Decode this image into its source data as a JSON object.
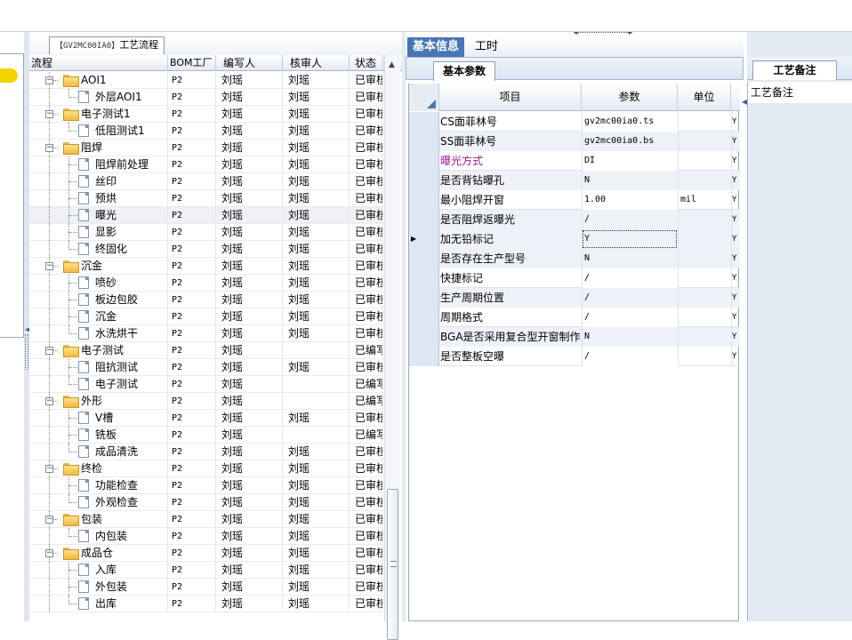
{
  "flow_panel": {
    "tab_title_code": "【GV2MC00IA0】",
    "tab_title_text": "工艺流程",
    "columns": [
      "流程",
      "BOM工厂",
      "编写人",
      "核审人",
      "状态"
    ],
    "rows": [
      {
        "name": "AOI1",
        "level": 0,
        "type": "folder",
        "bom": "P2",
        "writer": "刘瑶",
        "reviewer": "刘瑶",
        "status": "已审核"
      },
      {
        "name": "外层AOI1",
        "level": 1,
        "type": "doc",
        "bom": "P2",
        "writer": "刘瑶",
        "reviewer": "刘瑶",
        "status": "已审核"
      },
      {
        "name": "电子测试1",
        "level": 0,
        "type": "folder",
        "bom": "P2",
        "writer": "刘瑶",
        "reviewer": "刘瑶",
        "status": "已审核"
      },
      {
        "name": "低阻测试1",
        "level": 1,
        "type": "doc",
        "bom": "P2",
        "writer": "刘瑶",
        "reviewer": "刘瑶",
        "status": "已审核"
      },
      {
        "name": "阻焊",
        "level": 0,
        "type": "folder",
        "bom": "P2",
        "writer": "刘瑶",
        "reviewer": "刘瑶",
        "status": "已审核"
      },
      {
        "name": "阻焊前处理",
        "level": 1,
        "type": "doc",
        "bom": "P2",
        "writer": "刘瑶",
        "reviewer": "刘瑶",
        "status": "已审核"
      },
      {
        "name": "丝印",
        "level": 1,
        "type": "doc",
        "bom": "P2",
        "writer": "刘瑶",
        "reviewer": "刘瑶",
        "status": "已审核"
      },
      {
        "name": "预烘",
        "level": 1,
        "type": "doc",
        "bom": "P2",
        "writer": "刘瑶",
        "reviewer": "刘瑶",
        "status": "已审核"
      },
      {
        "name": "曝光",
        "level": 1,
        "type": "doc",
        "bom": "P2",
        "writer": "刘瑶",
        "reviewer": "刘瑶",
        "status": "已审核",
        "selected": true
      },
      {
        "name": "显影",
        "level": 1,
        "type": "doc",
        "bom": "P2",
        "writer": "刘瑶",
        "reviewer": "刘瑶",
        "status": "已审核"
      },
      {
        "name": "终固化",
        "level": 1,
        "type": "doc",
        "bom": "P2",
        "writer": "刘瑶",
        "reviewer": "刘瑶",
        "status": "已审核"
      },
      {
        "name": "沉金",
        "level": 0,
        "type": "folder",
        "bom": "P2",
        "writer": "刘瑶",
        "reviewer": "刘瑶",
        "status": "已审核"
      },
      {
        "name": "喷砂",
        "level": 1,
        "type": "doc",
        "bom": "P2",
        "writer": "刘瑶",
        "reviewer": "刘瑶",
        "status": "已审核"
      },
      {
        "name": "板边包胶",
        "level": 1,
        "type": "doc",
        "bom": "P2",
        "writer": "刘瑶",
        "reviewer": "刘瑶",
        "status": "已审核"
      },
      {
        "name": "沉金",
        "level": 1,
        "type": "doc",
        "bom": "P2",
        "writer": "刘瑶",
        "reviewer": "刘瑶",
        "status": "已审核"
      },
      {
        "name": "水洗烘干",
        "level": 1,
        "type": "doc",
        "bom": "P2",
        "writer": "刘瑶",
        "reviewer": "刘瑶",
        "status": "已审核"
      },
      {
        "name": "电子测试",
        "level": 0,
        "type": "folder",
        "bom": "P2",
        "writer": "刘瑶",
        "reviewer": "",
        "status": "已编写"
      },
      {
        "name": "阻抗测试",
        "level": 1,
        "type": "doc",
        "bom": "P2",
        "writer": "刘瑶",
        "reviewer": "刘瑶",
        "status": "已审核"
      },
      {
        "name": "电子测试",
        "level": 1,
        "type": "doc",
        "bom": "P2",
        "writer": "刘瑶",
        "reviewer": "",
        "status": "已编写"
      },
      {
        "name": "外形",
        "level": 0,
        "type": "folder",
        "bom": "P2",
        "writer": "刘瑶",
        "reviewer": "",
        "status": "已编写"
      },
      {
        "name": "V槽",
        "level": 1,
        "type": "doc",
        "bom": "P2",
        "writer": "刘瑶",
        "reviewer": "刘瑶",
        "status": "已审核"
      },
      {
        "name": "铣板",
        "level": 1,
        "type": "doc",
        "bom": "P2",
        "writer": "刘瑶",
        "reviewer": "",
        "status": "已编写"
      },
      {
        "name": "成品清洗",
        "level": 1,
        "type": "doc",
        "bom": "P2",
        "writer": "刘瑶",
        "reviewer": "刘瑶",
        "status": "已审核"
      },
      {
        "name": "终检",
        "level": 0,
        "type": "folder",
        "bom": "P2",
        "writer": "刘瑶",
        "reviewer": "刘瑶",
        "status": "已审核"
      },
      {
        "name": "功能检查",
        "level": 1,
        "type": "doc",
        "bom": "P2",
        "writer": "刘瑶",
        "reviewer": "刘瑶",
        "status": "已审核"
      },
      {
        "name": "外观检查",
        "level": 1,
        "type": "doc",
        "bom": "P2",
        "writer": "刘瑶",
        "reviewer": "刘瑶",
        "status": "已审核"
      },
      {
        "name": "包装",
        "level": 0,
        "type": "folder",
        "bom": "P2",
        "writer": "刘瑶",
        "reviewer": "刘瑶",
        "status": "已审核"
      },
      {
        "name": "内包装",
        "level": 1,
        "type": "doc",
        "bom": "P2",
        "writer": "刘瑶",
        "reviewer": "刘瑶",
        "status": "已审核"
      },
      {
        "name": "成品仓",
        "level": 0,
        "type": "folder",
        "bom": "P2",
        "writer": "刘瑶",
        "reviewer": "刘瑶",
        "status": "已审核"
      },
      {
        "name": "入库",
        "level": 1,
        "type": "doc",
        "bom": "P2",
        "writer": "刘瑶",
        "reviewer": "刘瑶",
        "status": "已审核"
      },
      {
        "name": "外包装",
        "level": 1,
        "type": "doc",
        "bom": "P2",
        "writer": "刘瑶",
        "reviewer": "刘瑶",
        "status": "已审核"
      },
      {
        "name": "出库",
        "level": 1,
        "type": "doc",
        "bom": "P2",
        "writer": "刘瑶",
        "reviewer": "刘瑶",
        "status": "已审核"
      }
    ]
  },
  "mid_panel": {
    "tabs": [
      {
        "label": "基本信息",
        "active": true
      },
      {
        "label": "工时",
        "active": false
      }
    ],
    "sub_tab": "基本参数",
    "columns": [
      "项目",
      "参数",
      "单位"
    ],
    "rows": [
      {
        "item": "CS面菲林号",
        "value": "gv2mc00ia0.ts",
        "unit": "",
        "flag": "Y",
        "white": true
      },
      {
        "item": "SS面菲林号",
        "value": "gv2mc00ia0.bs",
        "unit": "",
        "flag": "Y"
      },
      {
        "item": "曝光方式",
        "value": "DI",
        "unit": "",
        "flag": "Y",
        "white": true,
        "magenta": true
      },
      {
        "item": "是否背钻曝孔",
        "value": "N",
        "unit": "",
        "flag": "Y"
      },
      {
        "item": "最小阻焊开窗",
        "value": "1.00",
        "unit": "mil",
        "flag": "Y",
        "white": true
      },
      {
        "item": "是否阻焊返曝光",
        "value": "/",
        "unit": "",
        "flag": "Y"
      },
      {
        "item": "加无铅标记",
        "value": "Y",
        "unit": "",
        "flag": "Y",
        "current": true
      },
      {
        "item": "是否存在生产型号",
        "value": "N",
        "unit": "",
        "flag": "Y"
      },
      {
        "item": "快捷标记",
        "value": "/",
        "unit": "",
        "flag": "Y",
        "white": true
      },
      {
        "item": "生产周期位置",
        "value": "/",
        "unit": "",
        "flag": "Y"
      },
      {
        "item": "周期格式",
        "value": "/",
        "unit": "",
        "flag": "Y",
        "white": true
      },
      {
        "item": "BGA是否采用复合型开窗制作",
        "value": "N",
        "unit": "",
        "flag": "Y"
      },
      {
        "item": "是否整板空曝",
        "value": "/",
        "unit": "",
        "flag": "Y",
        "white": true
      }
    ]
  },
  "right_panel": {
    "tab": "工艺备注",
    "label": "工艺备注"
  },
  "icons": {
    "expander": "minus-box-icon",
    "folder": "folder-icon",
    "doc": "document-icon",
    "row_pointer": "triangle-right-icon"
  },
  "colors": {
    "active_tab": "#4a76b3",
    "folder": "#f0b940",
    "magenta_label": "#9b1a8a",
    "bubble": "#f2d400"
  }
}
